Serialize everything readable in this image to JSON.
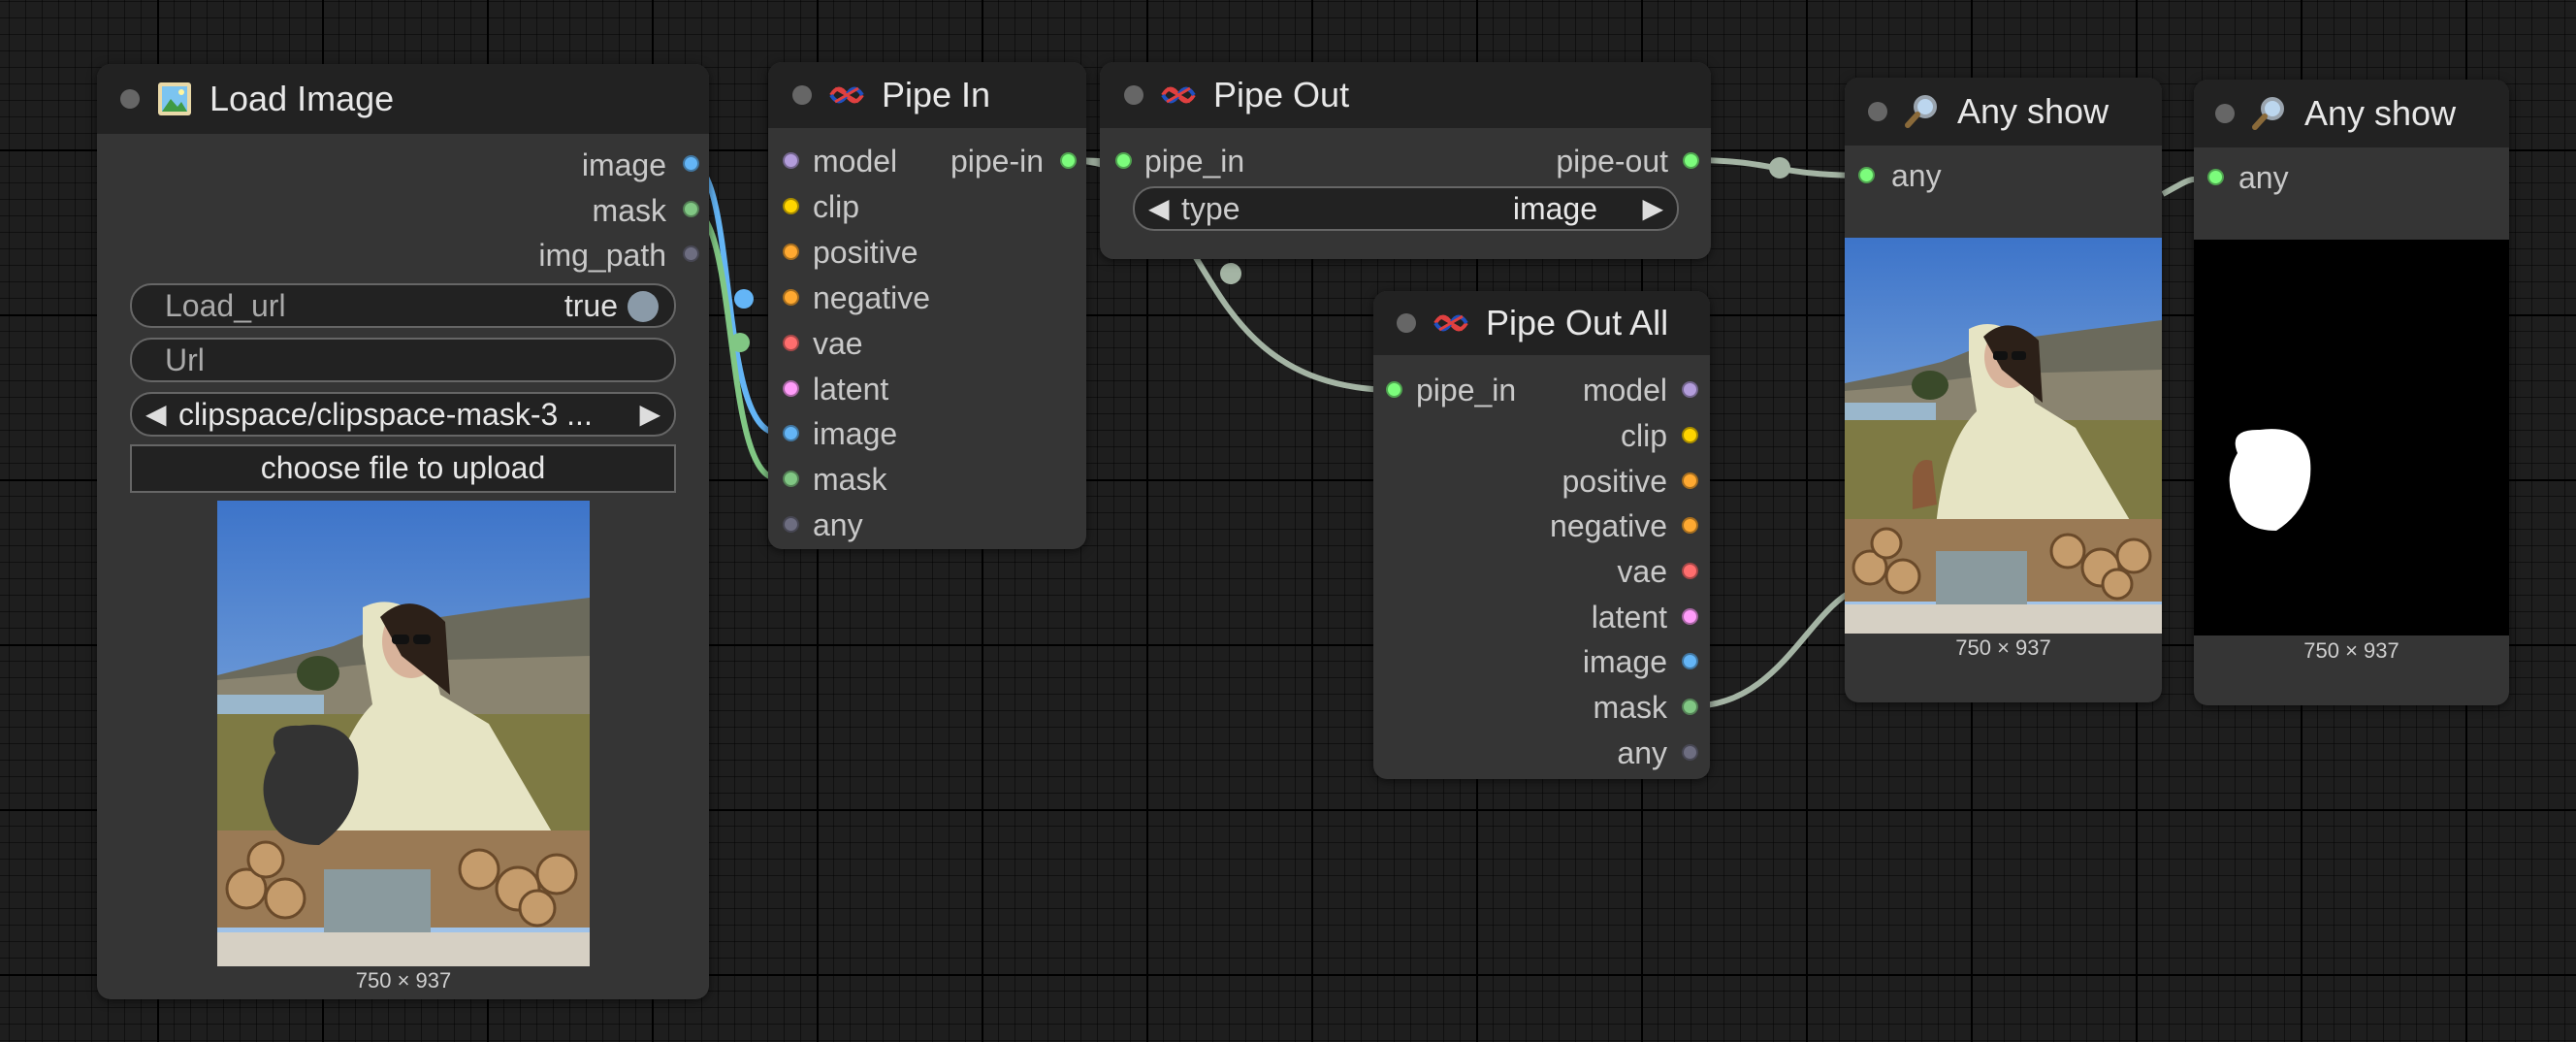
{
  "nodes": {
    "load_image": {
      "title": "Load Image",
      "outputs": [
        "image",
        "mask",
        "img_path"
      ],
      "widgets": {
        "load_url_label": "Load_url",
        "load_url_value": "true",
        "url_placeholder": "Url",
        "file_value": "clipspace/clipspace-mask-3 ...",
        "upload_label": "choose file to upload"
      },
      "image_dims": "750 × 937"
    },
    "pipe_in": {
      "title": "Pipe In",
      "inputs": [
        "model",
        "clip",
        "positive",
        "negative",
        "vae",
        "latent",
        "image",
        "mask",
        "any"
      ],
      "output": "pipe-in"
    },
    "pipe_out": {
      "title": "Pipe Out",
      "input": "pipe_in",
      "output": "pipe-out",
      "type_label": "type",
      "type_value": "image"
    },
    "pipe_out_all": {
      "title": "Pipe Out All",
      "input": "pipe_in",
      "outputs": [
        "model",
        "clip",
        "positive",
        "negative",
        "vae",
        "latent",
        "image",
        "mask",
        "any"
      ]
    },
    "any_show_1": {
      "title": "Any show",
      "input": "any",
      "image_dims": "750 × 937"
    },
    "any_show_2": {
      "title": "Any show",
      "input": "any",
      "image_dims": "750 × 937"
    }
  },
  "slot_colors": {
    "model": "#b39ddb",
    "clip": "#ffd500",
    "positive": "#ffa931",
    "negative": "#ffa931",
    "vae": "#ff6e6e",
    "latent": "#ff9cf9",
    "image": "#64b5f6",
    "mask": "#81c784",
    "any": "#6d6d80",
    "img_path": "#6d6d80",
    "pipe": "#7cfc7c"
  },
  "link_color": "#a4b4a4",
  "icons": {
    "load_image": "picture-frame-icon",
    "pipe": "pipe-knot-icon",
    "any_show": "magnifier-icon"
  }
}
